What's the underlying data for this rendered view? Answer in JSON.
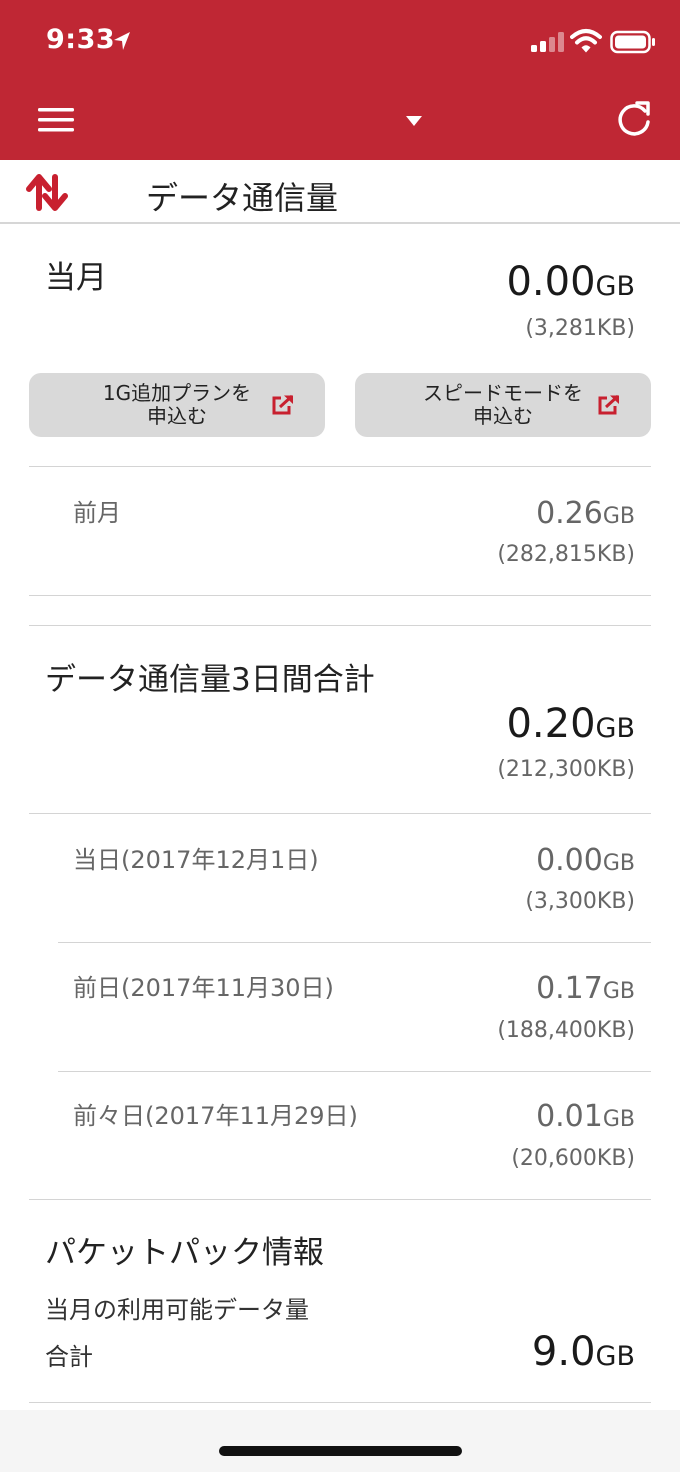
{
  "status_bar": {
    "time": "9:33"
  },
  "title_row": {
    "title": "データ通信量"
  },
  "current_month": {
    "label": "当月",
    "value": "0.00",
    "unit": "GB",
    "kb": "(3,281KB)",
    "buttons": [
      {
        "label": "1G追加プランを\n申込む"
      },
      {
        "label": "スピードモードを\n申込む"
      }
    ]
  },
  "previous_month": {
    "label": "前月",
    "value": "0.26",
    "unit": "GB",
    "kb": "(282,815KB)"
  },
  "three_day": {
    "label": "データ通信量3日間合計",
    "value": "0.20",
    "unit": "GB",
    "kb": "(212,300KB)",
    "days": [
      {
        "label": "当日(2017年12月1日)",
        "value": "0.00",
        "unit": "GB",
        "kb": "(3,300KB)"
      },
      {
        "label": "前日(2017年11月30日)",
        "value": "0.17",
        "unit": "GB",
        "kb": "(188,400KB)"
      },
      {
        "label": "前々日(2017年11月29日)",
        "value": "0.01",
        "unit": "GB",
        "kb": "(20,600KB)"
      }
    ]
  },
  "packet_pack": {
    "title": "パケットパック情報",
    "subtitle": "当月の利用可能データ量",
    "total_label": "合計",
    "total_value": "9.0",
    "total_unit": "GB"
  },
  "colors": {
    "header": "#bf2734",
    "accent": "#c8202f",
    "button": "#d9d9d9"
  }
}
